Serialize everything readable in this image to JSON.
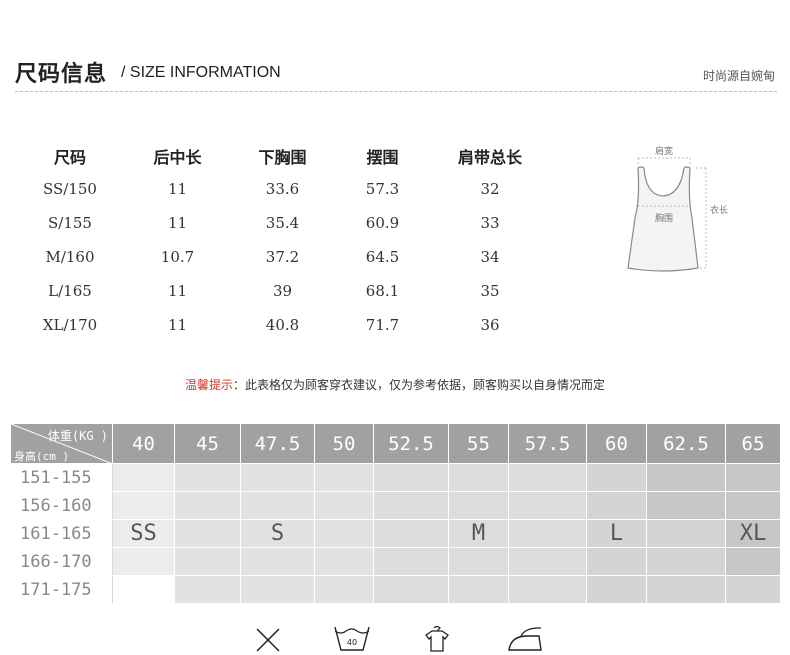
{
  "header": {
    "title_cn": "尺码信息",
    "title_en": "/ SIZE INFORMATION",
    "brand": "时尚源自婉甸"
  },
  "size_table": {
    "headers": [
      "尺码",
      "后中长",
      "下胸围",
      "摆围",
      "肩带总长"
    ],
    "rows": [
      [
        "SS/150",
        "11",
        "33.6",
        "57.3",
        "32"
      ],
      [
        "S/155",
        "11",
        "35.4",
        "60.9",
        "33"
      ],
      [
        "M/160",
        "10.7",
        "37.2",
        "64.5",
        "34"
      ],
      [
        "L/165",
        "11",
        "39",
        "68.1",
        "35"
      ],
      [
        "XL/170",
        "11",
        "40.8",
        "71.7",
        "36"
      ]
    ]
  },
  "diagram": {
    "shoulder_label": "肩宽",
    "length_label": "衣长",
    "bust_label": "胸围"
  },
  "tip": {
    "label": "温馨提示",
    "text": "：此表格仅为顾客穿衣建议，仅为参考依据，顾客购买以自身情况而定"
  },
  "recommend_grid": {
    "weight_header": "体重(KG )",
    "height_header": "身高(cm )",
    "weights": [
      "40",
      "45",
      "47.5",
      "50",
      "52.5",
      "55",
      "57.5",
      "60",
      "62.5",
      "65"
    ],
    "heights": [
      "151-155",
      "156-160",
      "161-165",
      "166-170",
      "171-175"
    ],
    "size_labels": {
      "ss": "SS",
      "s": "S",
      "m": "M",
      "l": "L",
      "xl": "XL"
    }
  },
  "care_icons": {
    "wash_temp": "40",
    "items": [
      "no-bleach-icon",
      "wash-40-icon",
      "hang-dry-icon",
      "iron-icon"
    ]
  }
}
